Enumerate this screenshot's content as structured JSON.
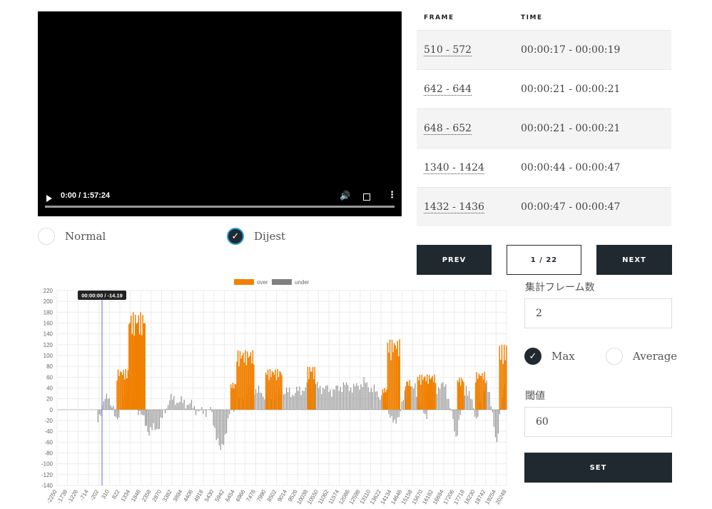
{
  "video": {
    "time": "0:00 / 1:57:24"
  },
  "modes": {
    "normal": "Normal",
    "dijest": "Dijest"
  },
  "table": {
    "headers": [
      "FRAME",
      "TIME"
    ],
    "rows": [
      {
        "frame": "510 - 572",
        "time": "00:00:17 - 00:00:19"
      },
      {
        "frame": "642 - 644",
        "time": "00:00:21 - 00:00:21"
      },
      {
        "frame": "648 - 652",
        "time": "00:00:21 - 00:00:21"
      },
      {
        "frame": "1340 - 1424",
        "time": "00:00:44 - 00:00:47"
      },
      {
        "frame": "1432 - 1436",
        "time": "00:00:47 - 00:00:47"
      }
    ]
  },
  "pager": {
    "prev": "PREV",
    "page": "1 / 22",
    "next": "NEXT"
  },
  "settings": {
    "frames_label": "集計フレーム数",
    "frames_value": "2",
    "max_label": "Max",
    "average_label": "Average",
    "threshold_label": "閾値",
    "threshold_value": "60",
    "set_label": "SET"
  },
  "colors": {
    "over": "#f08000",
    "under": "#808080",
    "dark": "#212930",
    "cursor": "#6666ff"
  },
  "chart_data": {
    "type": "bar",
    "legend": [
      {
        "name": "over",
        "color": "#f08000"
      },
      {
        "name": "under",
        "color": "#808080"
      }
    ],
    "legend_position": "top-center",
    "tooltip": "00:00:00 / -14.19",
    "ylim": [
      -140,
      220
    ],
    "yticks": [
      220,
      200,
      180,
      160,
      140,
      120,
      100,
      80,
      60,
      40,
      20,
      0,
      -20,
      -40,
      -60,
      -80,
      -100,
      -120,
      -140
    ],
    "xticks": [
      "-2250",
      "-1738",
      "-1226",
      "-714",
      "-202",
      "310",
      "822",
      "1334",
      "1846",
      "2358",
      "2870",
      "3382",
      "3894",
      "4406",
      "4918",
      "5430",
      "5942",
      "6454",
      "6966",
      "7478",
      "7990",
      "8502",
      "9014",
      "9526",
      "10038",
      "10550",
      "11062",
      "11574",
      "12086",
      "12598",
      "13110",
      "13622",
      "14134",
      "14646",
      "15158",
      "15670",
      "16182",
      "16694",
      "17206",
      "17718",
      "18230",
      "18742",
      "19254",
      "20248"
    ],
    "grid": true,
    "cursor_x": 0,
    "series": [
      {
        "name": "over",
        "segments": [
          {
            "x": [
              750,
              1350
            ],
            "y": 75
          },
          {
            "x": [
              1350,
              2150
            ],
            "y": 180
          },
          {
            "x": [
              6450,
              6700
            ],
            "y": 50
          },
          {
            "x": [
              6750,
              7600
            ],
            "y": 110
          },
          {
            "x": [
              8200,
              9000
            ],
            "y": 75
          },
          {
            "x": [
              10300,
              10650
            ],
            "y": 80
          },
          {
            "x": [
              14050,
              14300
            ],
            "y": 40
          },
          {
            "x": [
              14300,
              14900
            ],
            "y": 130
          },
          {
            "x": [
              15200,
              15450
            ],
            "y": 55
          },
          {
            "x": [
              15800,
              16700
            ],
            "y": 65
          },
          {
            "x": [
              17800,
              18100
            ],
            "y": 60
          },
          {
            "x": [
              18700,
              19200
            ],
            "y": 70
          },
          {
            "x": [
              19900,
              20248
            ],
            "y": 120
          }
        ]
      },
      {
        "name": "under",
        "envelope": [
          [
            -202,
            -15
          ],
          [
            300,
            30
          ],
          [
            700,
            -20
          ],
          [
            1334,
            40
          ],
          [
            2100,
            -20
          ],
          [
            2358,
            -40
          ],
          [
            2870,
            -30
          ],
          [
            3382,
            20
          ],
          [
            3894,
            15
          ],
          [
            4406,
            10
          ],
          [
            4918,
            -5
          ],
          [
            5430,
            0
          ],
          [
            5942,
            -80
          ],
          [
            6454,
            0
          ],
          [
            7478,
            40
          ],
          [
            8502,
            20
          ],
          [
            9014,
            35
          ],
          [
            9526,
            30
          ],
          [
            10550,
            45
          ],
          [
            11062,
            40
          ],
          [
            11574,
            35
          ],
          [
            12086,
            45
          ],
          [
            12598,
            40
          ],
          [
            13110,
            50
          ],
          [
            13622,
            35
          ],
          [
            14134,
            20
          ],
          [
            14646,
            -30
          ],
          [
            15158,
            25
          ],
          [
            15670,
            40
          ],
          [
            16182,
            -15
          ],
          [
            16694,
            40
          ],
          [
            17206,
            45
          ],
          [
            17718,
            -50
          ],
          [
            18230,
            45
          ],
          [
            18742,
            -15
          ],
          [
            19254,
            55
          ],
          [
            19766,
            -60
          ],
          [
            20248,
            80
          ]
        ]
      }
    ]
  }
}
